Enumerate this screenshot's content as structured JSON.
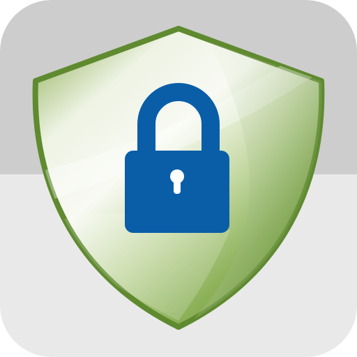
{
  "icon": {
    "name": "shield-lock-icon",
    "colors": {
      "tile_top": "#cdcdcd",
      "tile_bottom": "#e9e9e9",
      "shield_border": "#5f8a2f",
      "shield_light": "#f4f7ee",
      "shield_mid": "#b8cf95",
      "shield_dark": "#6e9734",
      "lock": "#0a5ea8",
      "keyhole": "#ffffff"
    }
  }
}
